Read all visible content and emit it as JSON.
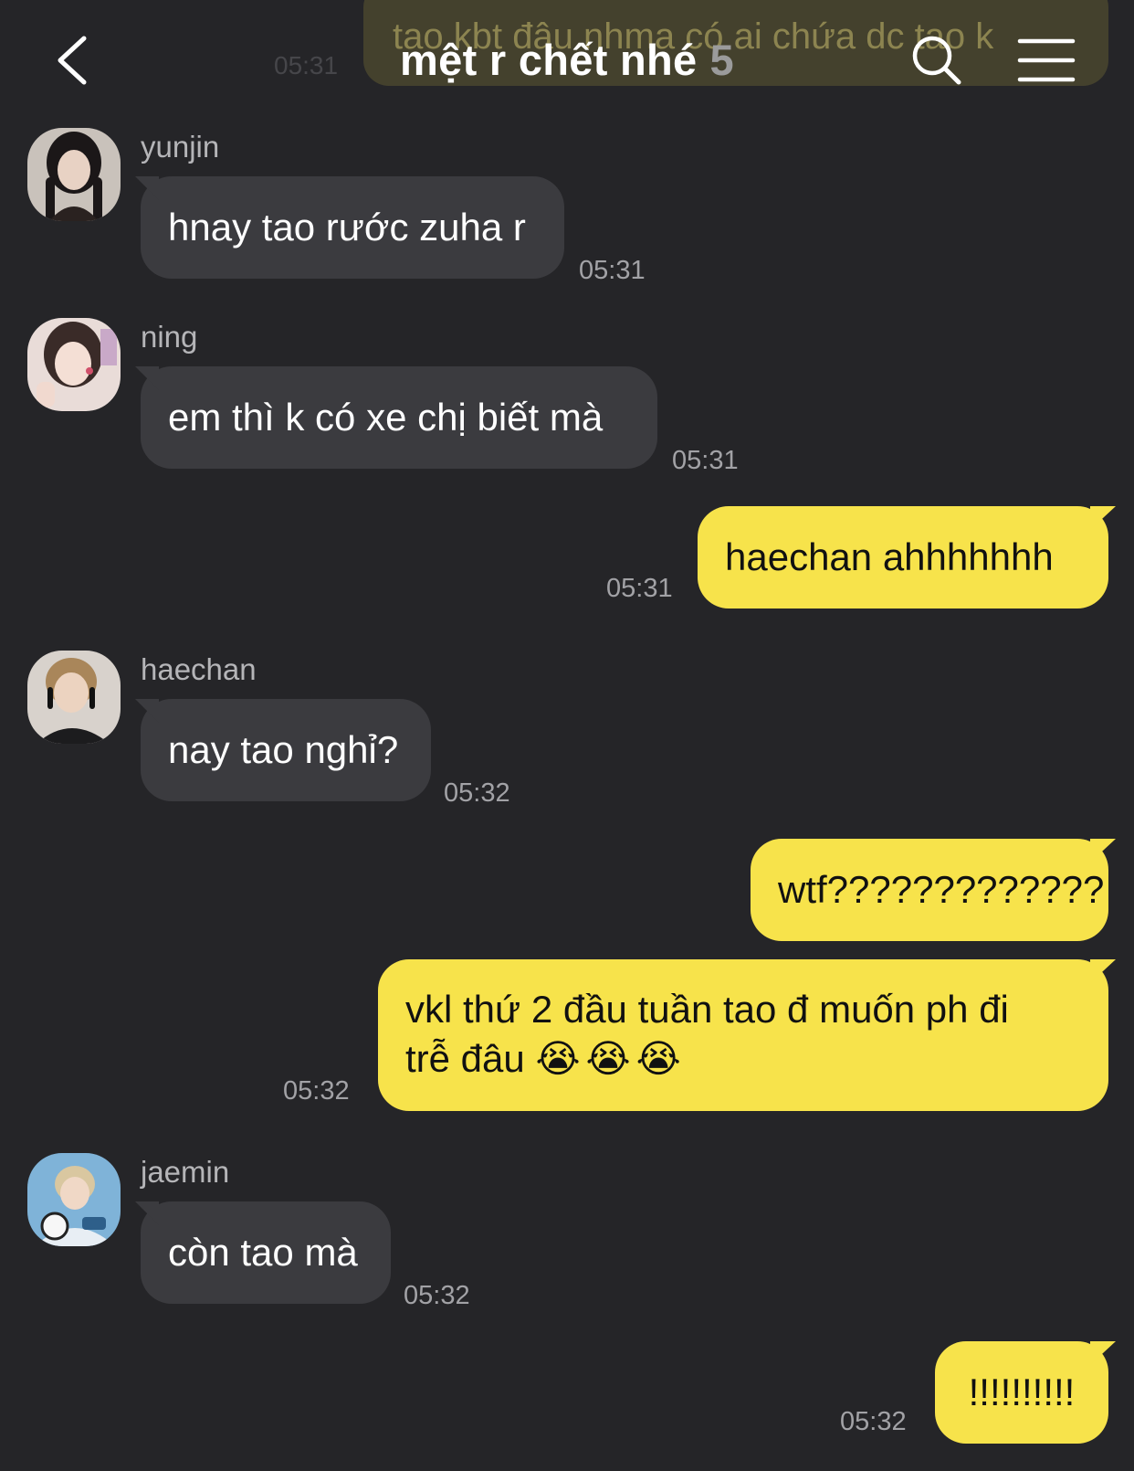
{
  "header": {
    "title": "mệt r chết nhé",
    "member_count": "5",
    "back_icon": "chevron-left-icon",
    "search_icon": "search-icon",
    "menu_icon": "hamburger-menu-icon"
  },
  "previous_message": {
    "text": "tao kbt đâu nhma có ai chứa dc tao k",
    "time": "05:31"
  },
  "messages": [
    {
      "direction": "in",
      "sender": "yunjin",
      "text": "hnay tao rước zuha r",
      "time": "05:31"
    },
    {
      "direction": "in",
      "sender": "ning",
      "text": "em thì k có xe chị biết mà",
      "time": "05:31"
    },
    {
      "direction": "out",
      "text": "haechan ahhhhhhh",
      "time": "05:31"
    },
    {
      "direction": "in",
      "sender": "haechan",
      "text": "nay tao nghỉ?",
      "time": "05:32"
    },
    {
      "direction": "out",
      "text": "wtf?????????????",
      "time": ""
    },
    {
      "direction": "out",
      "text_line1": "vkl thứ 2 đầu tuần tao đ muốn ph đi",
      "text_line2": "trễ đâu",
      "emoji": "😭😭😭",
      "time": "05:32"
    },
    {
      "direction": "in",
      "sender": "jaemin",
      "text": "còn tao mà",
      "time": "05:32"
    },
    {
      "direction": "out",
      "text": "!!!!!!!!!!",
      "time": "05:32"
    }
  ],
  "colors": {
    "background": "#252528",
    "incoming_bubble": "#3b3b3f",
    "outgoing_bubble": "#f7e34b",
    "timestamp": "#a2a2a6"
  }
}
